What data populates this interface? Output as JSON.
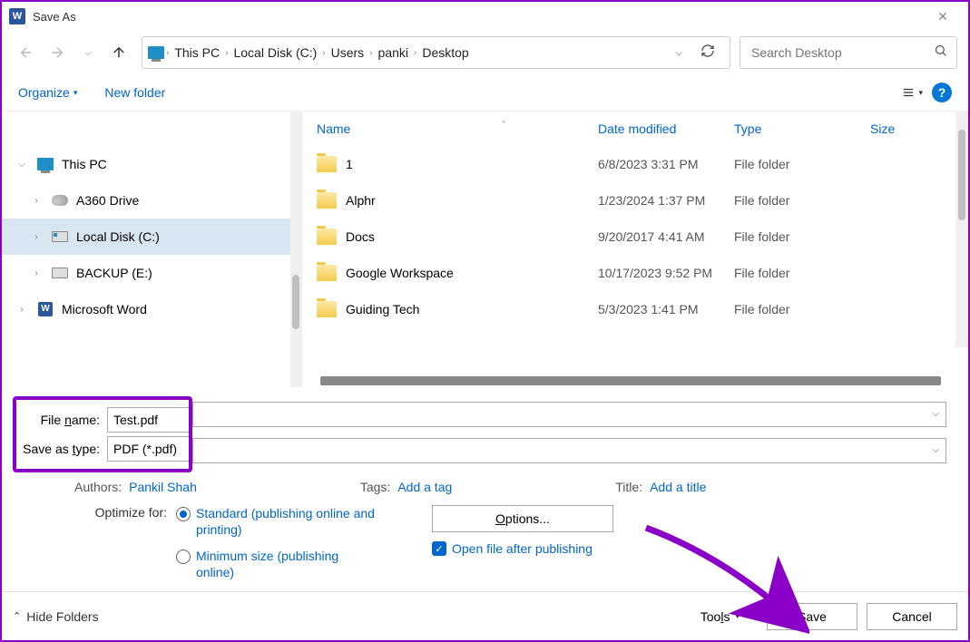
{
  "window": {
    "title": "Save As"
  },
  "breadcrumb": {
    "items": [
      "This PC",
      "Local Disk (C:)",
      "Users",
      "panki",
      "Desktop"
    ]
  },
  "search": {
    "placeholder": "Search Desktop"
  },
  "toolbar": {
    "organize": "Organize",
    "new_folder": "New folder"
  },
  "tree": {
    "items": [
      {
        "label": "This PC",
        "expanded": true,
        "level": 1,
        "icon": "pc"
      },
      {
        "label": "A360 Drive",
        "expanded": false,
        "level": 2,
        "icon": "cloud"
      },
      {
        "label": "Local Disk (C:)",
        "expanded": false,
        "level": 2,
        "icon": "disk-blue",
        "selected": true
      },
      {
        "label": "BACKUP (E:)",
        "expanded": false,
        "level": 2,
        "icon": "disk"
      },
      {
        "label": "Microsoft Word",
        "expanded": false,
        "level": 1,
        "icon": "word"
      }
    ]
  },
  "columns": {
    "name": "Name",
    "date": "Date modified",
    "type": "Type",
    "size": "Size"
  },
  "files": [
    {
      "name": "1",
      "date": "6/8/2023 3:31 PM",
      "type": "File folder"
    },
    {
      "name": "Alphr",
      "date": "1/23/2024 1:37 PM",
      "type": "File folder"
    },
    {
      "name": "Docs",
      "date": "9/20/2017 4:41 AM",
      "type": "File folder"
    },
    {
      "name": "Google Workspace",
      "date": "10/17/2023 9:52 PM",
      "type": "File folder"
    },
    {
      "name": "Guiding Tech",
      "date": "5/3/2023 1:41 PM",
      "type": "File folder"
    }
  ],
  "filename": {
    "label": "File name:",
    "value": "Test.pdf"
  },
  "filetype": {
    "label": "Save as type:",
    "value": "PDF (*.pdf)"
  },
  "meta": {
    "authors_label": "Authors:",
    "authors_value": "Pankil Shah",
    "tags_label": "Tags:",
    "tags_value": "Add a tag",
    "title_label": "Title:",
    "title_value": "Add a title"
  },
  "optimize": {
    "label": "Optimize for:",
    "standard": "Standard (publishing online and printing)",
    "minimum": "Minimum size (publishing online)"
  },
  "options_button": "Options...",
  "open_after": "Open file after publishing",
  "footer": {
    "hide_folders": "Hide Folders",
    "tools": "Tools",
    "save": "Save",
    "cancel": "Cancel"
  }
}
